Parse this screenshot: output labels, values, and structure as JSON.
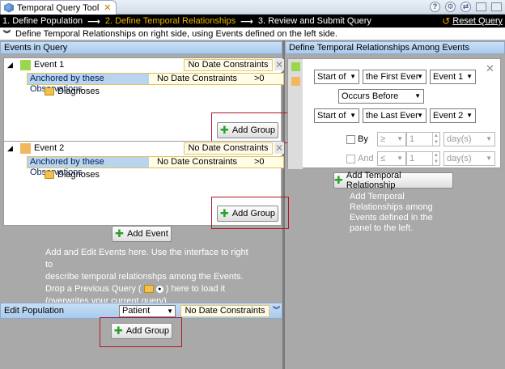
{
  "window": {
    "title": "Temporal Query Tool",
    "close_glyph": "✕"
  },
  "wizard": {
    "steps": [
      "1. Define Population",
      "2. Define Temporal Relationships",
      "3. Review and Submit Query"
    ],
    "arrow": "⟶",
    "reset_label": "Reset Query"
  },
  "instruction": "Define Temporal Relationships on right side, using Events defined on the left side.",
  "left_panel": {
    "header": "Events in Query",
    "events": [
      {
        "name": "Event 1",
        "color": "#9cd64a",
        "date_constraint": "No Date Constraints",
        "anchor_label": "Anchored by these Observations",
        "anchor_date": "No Date Constraints",
        "anchor_gt": ">0",
        "concept": "Diagnoses",
        "add_group": "Add Group"
      },
      {
        "name": "Event 2",
        "color": "#f2b860",
        "date_constraint": "No Date Constraints",
        "anchor_label": "Anchored by these Observations",
        "anchor_date": "No Date Constraints",
        "anchor_gt": ">0",
        "concept": "Diagnoses",
        "add_group": "Add Group"
      }
    ],
    "add_event": "Add Event",
    "help_lines": [
      "Add and Edit Events here. Use the interface to right to",
      "describe temporal relationshps among the Events.",
      "Drop a Previous Query (",
      ") here to load it",
      "(overwrites your current query)."
    ]
  },
  "edit_population": {
    "label": "Edit Population",
    "select_value": "Patient",
    "date_constraint": "No Date Constraints",
    "add_group": "Add Group"
  },
  "right_panel": {
    "header": "Define Temporal Relationships Among Events",
    "row1": {
      "start": "Start of",
      "which": "the First Ever",
      "event": "Event 1"
    },
    "operator": "Occurs Before",
    "row2": {
      "start": "Start of",
      "which": "the Last Ever",
      "event": "Event 2"
    },
    "by": {
      "label": "By",
      "op": "≥",
      "value": "1",
      "unit": "day(s)"
    },
    "and": {
      "label": "And",
      "op": "≤",
      "value": "1",
      "unit": "day(s)"
    },
    "add_button": "Add Temporal Relationship",
    "help_lines": [
      "Add Temporal",
      "Relationships among",
      "Events defined in the",
      "panel to the left."
    ]
  }
}
